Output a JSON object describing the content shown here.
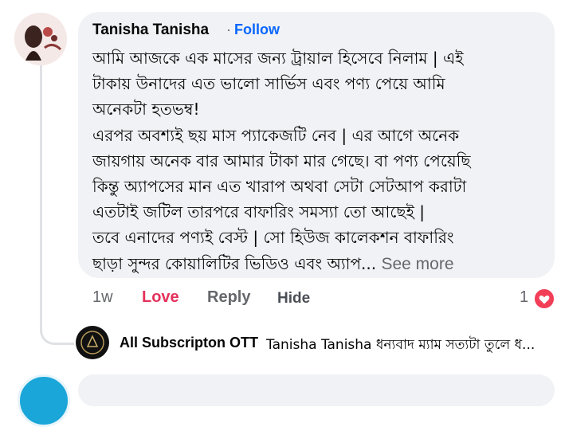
{
  "comment": {
    "author": "Tanisha Tanisha",
    "follow_label": "Follow",
    "lines": [
      "আমি আজকে এক মাসের জন্য ট্রায়াল হিসেবে নিলাম | এই",
      "টাকায় উনাদের এত ভালো সার্ভিস এবং পণ্য পেয়ে আমি",
      "অনেকটা হতভম্ব!",
      "এরপর অবশ্যই ছয় মাস প্যাকেজটি নেব | এর আগে অনেক",
      "জায়গায় অনেক বার আমার টাকা মার গেছে। বা পণ্য পেয়েছি",
      "কিন্তু অ্যাপসের মান এত খারাপ অথবা সেটা সেটআপ করাটা",
      "এতটাই জটিল তারপরে বাফারিং সমস্যা তো আছেই |",
      "তবে এনাদের পণ্যই বেস্ট | সো হিউজ কালেকশন বাফারিং"
    ],
    "last_line": "ছাড়া সুন্দর কোয়ালিটির ভিডিও এবং অ্যাপ...",
    "see_more": "See more"
  },
  "actions": {
    "time": "1w",
    "love": "Love",
    "reply": "Reply",
    "hide": "Hide",
    "reaction_count": "1"
  },
  "reply": {
    "author": "All Subscripton OTT",
    "text": "Tanisha Tanisha ধন্যবাদ ম্যাম  সত্যটা তুলে ধ..."
  },
  "colors": {
    "bubble": "#f0f2f5",
    "follow": "#0866ff",
    "love": "#e4325b",
    "meta": "#65676b"
  },
  "icons": {
    "reaction": "love-heart-icon"
  }
}
